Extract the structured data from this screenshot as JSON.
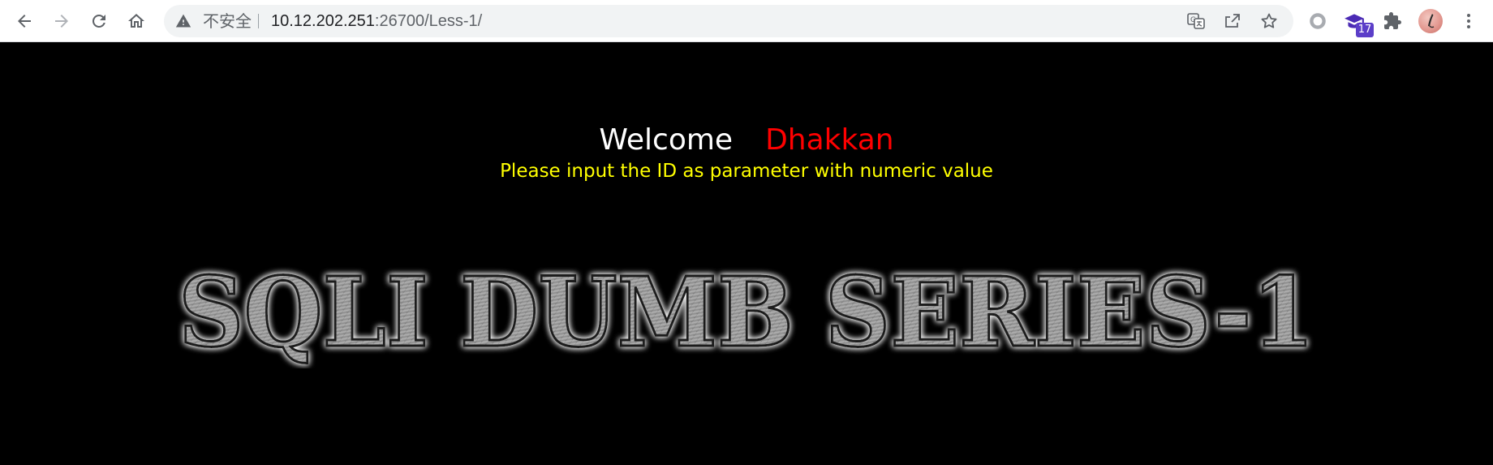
{
  "browser": {
    "address_bar": {
      "security_label": "不安全",
      "url_host": "10.12.202.251",
      "url_rest": ":26700/Less-1/"
    },
    "extensions_badge": "17",
    "icons": [
      "back-icon",
      "forward-icon",
      "reload-icon",
      "home-icon",
      "warning-icon",
      "translate-icon",
      "share-icon",
      "star-icon",
      "extension-circle-icon",
      "graduation-cap-icon",
      "puzzle-icon",
      "avatar",
      "menu-icon"
    ]
  },
  "page": {
    "welcome_text": "Welcome",
    "user_name": "Dhakkan",
    "instruction": "Please input the ID as parameter with numeric value",
    "banner_text": "SQLI DUMB SERIES-1",
    "colors": {
      "background": "#000000",
      "welcome": "#ffffff",
      "user_name": "#ff0000",
      "instruction": "#ffff00"
    }
  }
}
